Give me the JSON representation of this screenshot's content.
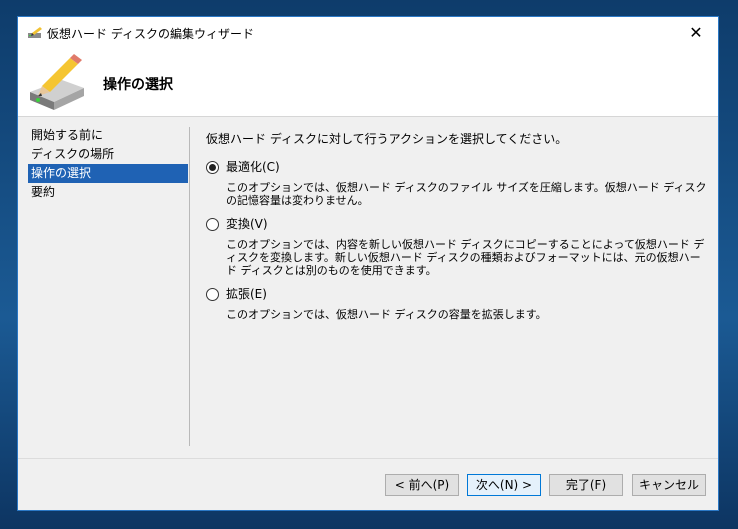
{
  "window": {
    "title": "仮想ハード ディスクの編集ウィザード",
    "close_glyph": "✕"
  },
  "header": {
    "title": "操作の選択"
  },
  "nav": {
    "items": [
      {
        "label": "開始する前に"
      },
      {
        "label": "ディスクの場所"
      },
      {
        "label": "操作の選択"
      },
      {
        "label": "要約"
      }
    ]
  },
  "main": {
    "prompt": "仮想ハード ディスクに対して行うアクションを選択してください。",
    "options": [
      {
        "label": "最適化(C)",
        "checked": true,
        "desc": "このオプションでは、仮想ハード ディスクのファイル サイズを圧縮します。仮想ハード ディスクの記憶容量は変わりません。"
      },
      {
        "label": "変換(V)",
        "checked": false,
        "desc": "このオプションでは、内容を新しい仮想ハード ディスクにコピーすることによって仮想ハード ディスクを変換します。新しい仮想ハード ディスクの種類およびフォーマットには、元の仮想ハード ディスクとは別のものを使用できます。"
      },
      {
        "label": "拡張(E)",
        "checked": false,
        "desc": "このオプションでは、仮想ハード ディスクの容量を拡張します。"
      }
    ]
  },
  "footer": {
    "prev_label": "< 前へ(P)",
    "next_label": "次へ(N) >",
    "finish_label": "完了(F)",
    "cancel_label": "キャンセル"
  },
  "colors": {
    "accent": "#1f62b4",
    "focus_border": "#0078d7"
  },
  "icons": {
    "title": "disk-pencil-icon",
    "header": "disk-pencil-icon",
    "close": "close-icon"
  }
}
